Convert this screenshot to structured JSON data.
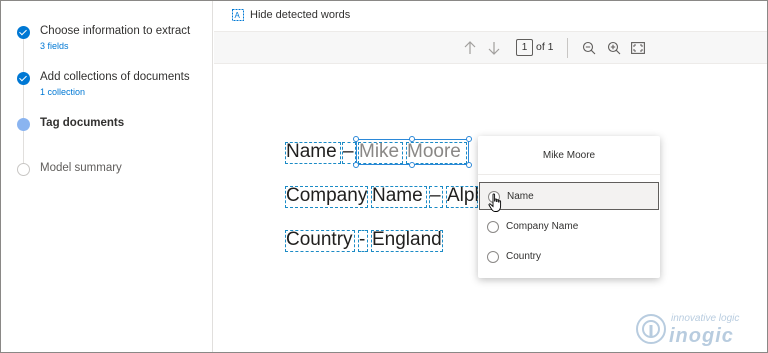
{
  "sidebar": {
    "steps": [
      {
        "title": "Choose information to extract",
        "sub": "3 fields",
        "state": "done"
      },
      {
        "title": "Add collections of documents",
        "sub": "1 collection",
        "state": "done"
      },
      {
        "title": "Tag documents",
        "sub": "",
        "state": "current"
      },
      {
        "title": "Model summary",
        "sub": "",
        "state": "todo"
      }
    ]
  },
  "commandbar": {
    "hide_words_label": "Hide detected words",
    "hide_words_icon": "text-detect-icon"
  },
  "toolbar": {
    "page_current": "1",
    "page_of": "of 1",
    "icons": [
      "arrow-up-icon",
      "arrow-down-icon",
      "zoom-out-icon",
      "zoom-in-icon",
      "fit-page-icon"
    ]
  },
  "document": {
    "line1": {
      "label": "Name",
      "dash": "–",
      "w1": "Mike",
      "w2": "Moore"
    },
    "line2": {
      "w1": "Company",
      "w2": "Name",
      "dash": "–",
      "w3": "Alph"
    },
    "line3": {
      "w1": "Country",
      "dash": "-",
      "w2": "England"
    }
  },
  "popup": {
    "title": "Mike Moore",
    "options": [
      "Name",
      "Company Name",
      "Country"
    ],
    "hovered_index": 0
  },
  "watermark": {
    "tagline": "innovative logic",
    "brand": "inogic"
  },
  "colors": {
    "accent": "#0078d4",
    "current_step": "#8ab4f0",
    "word_box": "#1b8bc6"
  }
}
